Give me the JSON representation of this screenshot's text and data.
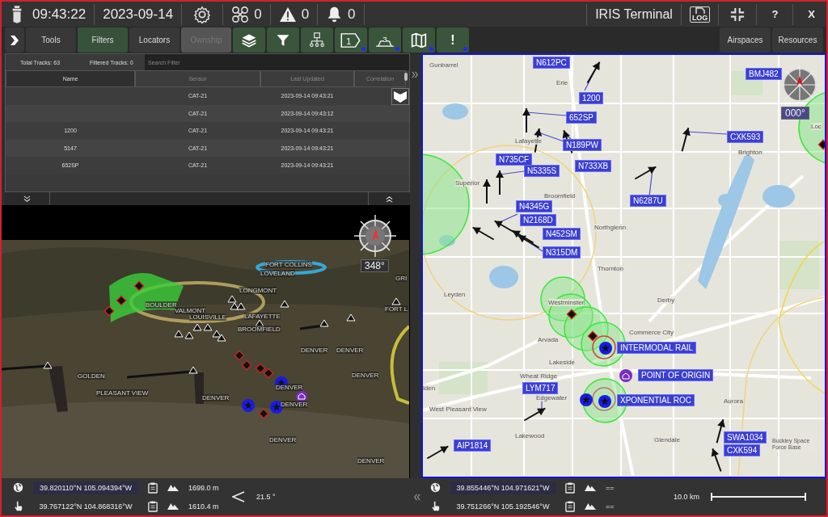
{
  "header": {
    "time": "09:43:22",
    "date": "2023-09-14",
    "drone_count": "0",
    "warning_count": "0",
    "alert_count": "0",
    "title": "IRIS Terminal",
    "log_label": "LOG",
    "help": "?",
    "close": "X"
  },
  "toolbar": {
    "tabs": [
      {
        "label": "Tools",
        "selected": false,
        "disabled": false
      },
      {
        "label": "Filters",
        "selected": true,
        "disabled": false
      },
      {
        "label": "Locators",
        "selected": false,
        "disabled": false
      },
      {
        "label": "Ownship",
        "selected": false,
        "disabled": true
      }
    ],
    "icon_buttons": [
      {
        "kind": "layers",
        "indicator": false
      },
      {
        "kind": "filter",
        "indicator": false
      },
      {
        "kind": "hierarchy",
        "indicator": false
      },
      {
        "kind": "tag",
        "label": "1",
        "indicator": true
      },
      {
        "kind": "altitude",
        "label": "3",
        "indicator": true
      },
      {
        "kind": "map",
        "indicator": true
      },
      {
        "kind": "alert",
        "label": "!",
        "indicator": true
      }
    ],
    "right_tabs": [
      {
        "label": "Airspaces",
        "selected": false
      },
      {
        "label": "Resources",
        "selected": false
      }
    ]
  },
  "track_table": {
    "total": "Total Tracks: 63",
    "filtered": "Filtered Tracks: 0",
    "search": {
      "placeholder": "Search Filter"
    },
    "columns": [
      {
        "label": "Name",
        "sorted": true
      },
      {
        "label": "Sensor",
        "sorted": false
      },
      {
        "label": "Last Updated",
        "sorted": false
      },
      {
        "label": "Correlation",
        "sorted": false
      }
    ],
    "rows": [
      {
        "sensor": "CAT-21",
        "last_updated": "2023-09-14 09:43:21"
      },
      {
        "sensor": "CAT-21",
        "last_updated": "2023-09-14 09:43:12"
      },
      {
        "name": "1200",
        "sensor": "CAT-21",
        "last_updated": "2023-09-14 09:43:21"
      },
      {
        "name": "5147",
        "sensor": "CAT-21",
        "last_updated": "2023-09-14 09:43:21"
      },
      {
        "name": "652SP",
        "sensor": "CAT-21",
        "last_updated": "2023-09-14 09:43:21"
      }
    ]
  },
  "view_3d": {
    "heading": "348°",
    "place_labels": [
      "FORT COLLINS",
      "LOVELAND",
      "LONGMONT",
      "BOULDER",
      "VALMONT",
      "LOUISVILLE",
      "LAFAYETTE",
      "BROOMFIELD",
      "DENVER",
      "DENVER",
      "GRI",
      "FORT L",
      "DENVER",
      "GOLDEN",
      "PLEASANT VIEW",
      "DENVER",
      "DENVER",
      "DENVER",
      "DENVER",
      "DENVER"
    ]
  },
  "map": {
    "heading": "000°",
    "place_labels": [
      "Gunbarrel",
      "Erie",
      "Lafayette",
      "Superior",
      "Broomfield",
      "Northglenn",
      "Thornton",
      "Leyden",
      "Westminster",
      "Arvada",
      "Derby",
      "Commerce City",
      "Lakeside",
      "Wheat Ridge",
      "Edgewater",
      "West Pleasant View",
      "Lakewood",
      "Glendale",
      "Aurora",
      "Brighton",
      "Buckley Space Force Base",
      "Loc",
      "lden"
    ],
    "track_labels": [
      "N612PC",
      "1200",
      "652SP",
      "N189PW",
      "N733XB",
      "N735CF",
      "N5335S",
      "CXK593",
      "BMJ482",
      "N6287U",
      "N4345G",
      "N2168D",
      "N452SM",
      "N315DM",
      "INTERMODAL RAIL",
      "POINT OF ORIGIN",
      "LYM717",
      "XPONENTIAL ROC",
      "AIP1814",
      "SWA1034",
      "CXK594"
    ]
  },
  "left_status": {
    "rows": [
      {
        "kind": "cursor",
        "coords": "39.820110°N 105.094394°W",
        "altitude": "1699.0 m"
      },
      {
        "kind": "pointer",
        "coords": "39.767122°N 104.868316°W",
        "altitude": "1610.4 m"
      }
    ],
    "tilt": "21.5 °"
  },
  "right_status": {
    "rows": [
      {
        "kind": "cursor",
        "coords": "39.855446°N 104.971621°W",
        "altitude": "=="
      },
      {
        "kind": "pointer",
        "coords": "39.751266°N 105.192546°W",
        "altitude": "=="
      }
    ],
    "scale": "10.0 km"
  }
}
